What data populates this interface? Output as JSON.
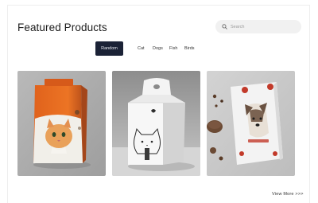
{
  "header": {
    "title": "Featured Products"
  },
  "search": {
    "icon": "search-icon",
    "placeholder": "Search"
  },
  "filters": {
    "items": [
      {
        "label": "Random",
        "active": true
      },
      {
        "label": "Cat",
        "active": false
      },
      {
        "label": "Dogs",
        "active": false
      },
      {
        "label": "Fish",
        "active": false
      },
      {
        "label": "Birds",
        "active": false
      }
    ],
    "active_color": "#1b2236"
  },
  "products": [
    {
      "name": "orange-cat-food-bag-image"
    },
    {
      "name": "white-cat-food-box-image"
    },
    {
      "name": "white-dog-food-pouch-image"
    }
  ],
  "footer": {
    "view_more": "View More >>>"
  }
}
